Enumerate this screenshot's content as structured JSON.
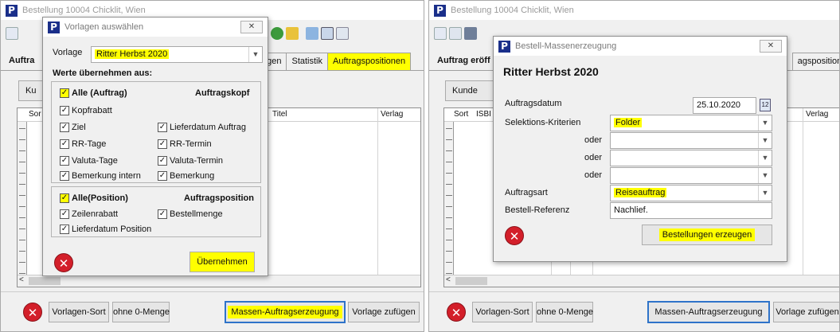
{
  "left": {
    "window_title": "Bestellung 10004 Chicklit, Wien",
    "tabs": [
      "Auftra",
      "kungen",
      "Statistik",
      "Auftragspositionen"
    ],
    "kunde_button": "Ku",
    "grid_headers": [
      "Sor",
      "Titel",
      "Verlag"
    ],
    "bottom": {
      "vorlagen_sort": "Vorlagen-Sort",
      "ohne_menge": "ohne 0-Menge",
      "massen": "Massen-Auftragserzeugung",
      "vorlage_zufuegen": "Vorlage zufügen"
    },
    "dialog": {
      "title": "Vorlagen auswählen",
      "vorlage_label": "Vorlage",
      "vorlage_value": "Ritter Herbst 2020",
      "werte_label": "Werte übernehmen aus:",
      "kopf": {
        "heading": "Auftragskopf",
        "alle": "Alle (Auftrag)",
        "kopfrabatt": "Kopfrabatt",
        "ziel": "Ziel",
        "lieferdatum_auftrag": "Lieferdatum Auftrag",
        "rr_tage": "RR-Tage",
        "rr_termin": "RR-Termin",
        "valuta_tage": "Valuta-Tage",
        "valuta_termin": "Valuta-Termin",
        "bemerkung_intern": "Bemerkung intern",
        "bemerkung": "Bemerkung"
      },
      "position": {
        "heading": "Auftragsposition",
        "alle": "Alle(Position)",
        "zeilenrabatt": "Zeilenrabatt",
        "bestellmenge": "Bestellmenge",
        "lieferdatum_position": "Lieferdatum Position"
      },
      "ubernehmen": "Übernehmen"
    }
  },
  "right": {
    "window_title": "Bestellung 10004 Chicklit, Wien",
    "tabs": [
      "Auftrag eröff",
      "agspositionen"
    ],
    "kunde_button": "Kunde",
    "grid_headers": [
      "Sort",
      "ISBI",
      "Verlag"
    ],
    "bottom": {
      "vorlagen_sort": "Vorlagen-Sort",
      "ohne_menge": "ohne 0-Menge",
      "massen": "Massen-Auftragserzeugung",
      "vorlage_zufuegen": "Vorlage zufügen"
    },
    "dialog": {
      "title": "Bestell-Massenerzeugung",
      "heading": "Ritter Herbst 2020",
      "auftragsdatum_label": "Auftragsdatum",
      "auftragsdatum_value": "25.10.2020",
      "calendar_label": "12",
      "selektion_label": "Selektions-Kriterien",
      "selektion_value": "Folder",
      "oder": "oder",
      "auftragsart_label": "Auftragsart",
      "auftragsart_value": "Reiseauftrag",
      "referenz_label": "Bestell-Referenz",
      "referenz_value": "Nachlief.",
      "erzeugen": "Bestellungen erzeugen"
    }
  },
  "colors": {
    "highlight": "#ffff00",
    "logo": "#1a2f8a",
    "cancel": "#d31f2a",
    "focus": "#2e73c9"
  }
}
